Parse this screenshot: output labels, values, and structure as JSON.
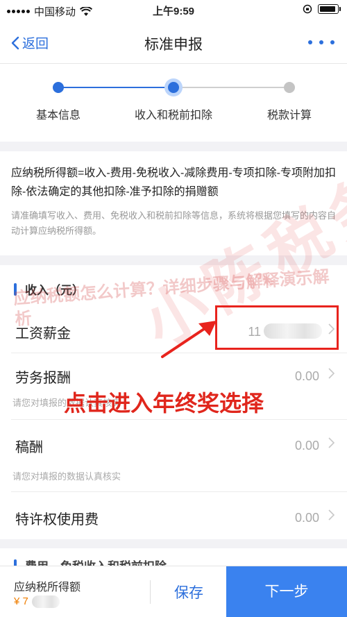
{
  "status_bar": {
    "carrier": "中国移动",
    "time": "上午9:59"
  },
  "nav": {
    "back_label": "返回",
    "title": "标准申报"
  },
  "steps": [
    {
      "label": "基本信息",
      "state": "done"
    },
    {
      "label": "收入和税前扣除",
      "state": "current"
    },
    {
      "label": "税款计算",
      "state": "pending"
    }
  ],
  "formula": {
    "text": "应纳税所得额=收入-费用-免税收入-减除费用-专项扣除-专项附加扣除-依法确定的其他扣除-准予扣除的捐赠额",
    "hint": "请准确填写收入、费用、免税收入和税前扣除等信息，系统将根据您填写的内容自动计算应纳税所得额。"
  },
  "income": {
    "section_title": "收入（元）",
    "rows": [
      {
        "label": "工资薪金",
        "value": "11"
      },
      {
        "label": "劳务报酬",
        "value": "0.00",
        "hint": "请您对填报的数据认真核实"
      },
      {
        "label": "稿酬",
        "value": "0.00",
        "hint": "请您对填报的数据认真核实"
      },
      {
        "label": "特许权使用费",
        "value": "0.00"
      }
    ]
  },
  "next_section_title": "费用、免税收入和税前扣除",
  "overlay": {
    "watermark_text": "应纳税额怎么计算？详细步骤与解释演示解析",
    "watermark_big": "小陈税务原创",
    "annotation": "点击进入年终奖选择"
  },
  "bottom": {
    "label": "应纳税所得额",
    "amount": "¥ 7",
    "save_label": "保存",
    "next_label": "下一步"
  },
  "colors": {
    "accent": "#2c6fdc",
    "primary_button": "#3a82ef",
    "annotation_red": "#e8231d",
    "amount_orange": "#ef7d00"
  }
}
